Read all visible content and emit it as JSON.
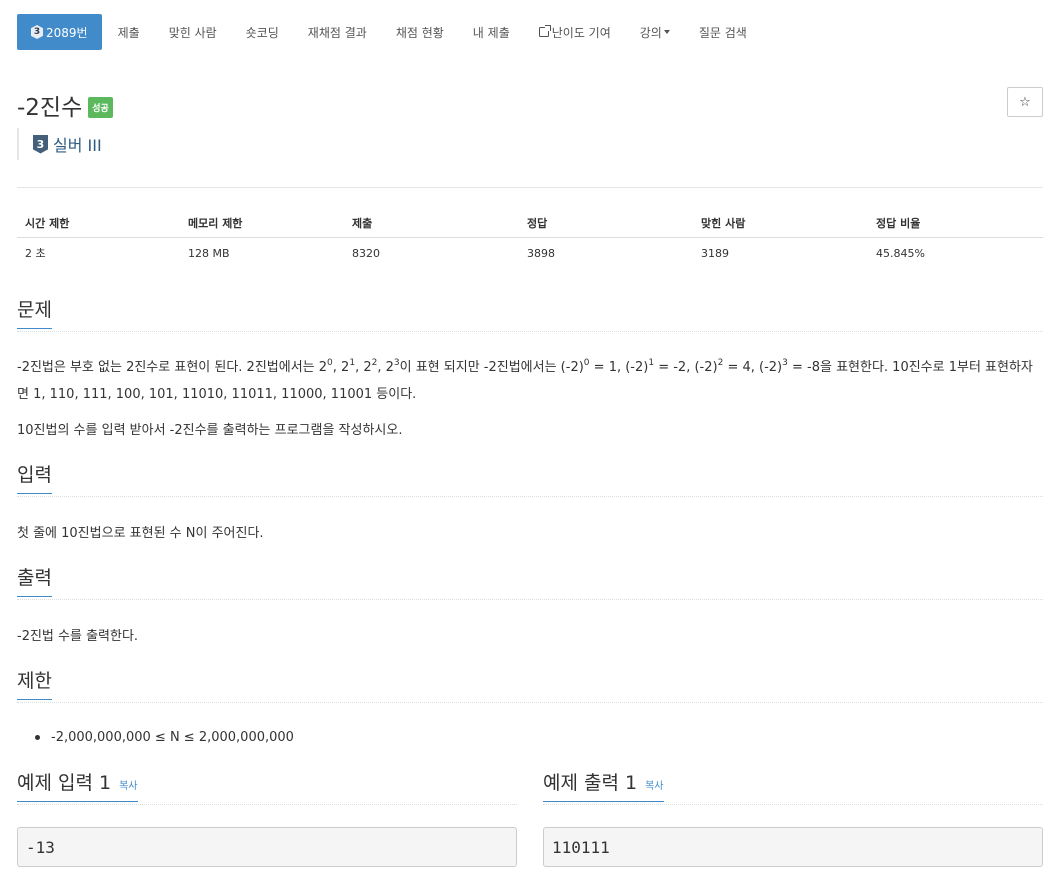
{
  "nav": {
    "active_tier": "3",
    "active_label": "2089번",
    "items": [
      "제출",
      "맞힌 사람",
      "숏코딩",
      "재채점 결과",
      "채점 현황",
      "내 제출",
      "난이도 기여",
      "강의",
      "질문 검색"
    ]
  },
  "problem": {
    "title": "-2진수",
    "status_label": "성공",
    "star_icon": "☆",
    "tier_number": "3",
    "tier_name": "실버 III"
  },
  "stats": {
    "headers": [
      "시간 제한",
      "메모리 제한",
      "제출",
      "정답",
      "맞힌 사람",
      "정답 비율"
    ],
    "values": [
      "2 초",
      "128 MB",
      "8320",
      "3898",
      "3189",
      "45.845%"
    ]
  },
  "sections": {
    "description_title": "문제",
    "description_p1_parts": [
      "-2진법은 부호 없는 2진수로 표현이 된다. 2진법에서는 2",
      "0",
      ", 2",
      "1",
      ", 2",
      "2",
      ", 2",
      "3",
      "이 표현 되지만 -2진법에서는 (-2)",
      "0",
      " = 1, (-2)",
      "1",
      " = -2, (-2)",
      "2",
      " = 4, (-2)",
      "3",
      " = -8을 표현한다. 10진수로 1부터 표현하자면 1, 110, 111, 100, 101, 11010, 11011, 11000, 11001 등이다."
    ],
    "description_p2": "10진법의 수를 입력 받아서 -2진수를 출력하는 프로그램을 작성하시오.",
    "input_title": "입력",
    "input_text": "첫 줄에 10진법으로 표현된 수 N이 주어진다.",
    "output_title": "출력",
    "output_text": "-2진법 수를 출력한다.",
    "limit_title": "제한",
    "limit_item": "-2,000,000,000 ≤ N ≤ 2,000,000,000"
  },
  "samples": {
    "input_title": "예제 입력 1",
    "output_title": "예제 출력 1",
    "copy_label": "복사",
    "input_value": "-13",
    "output_value": "110111"
  },
  "colors": {
    "accent": "#428bca",
    "success": "#5cb85c",
    "tier": "#435f7a"
  }
}
